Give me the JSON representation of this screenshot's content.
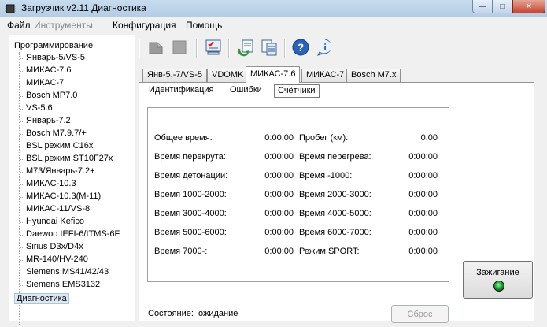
{
  "window": {
    "title": "Загрузчик v2.11 Диагностика",
    "controls": {
      "minimize": "—",
      "maximize": "□",
      "close": "✕"
    }
  },
  "menu": [
    "Файл",
    "Инструменты",
    "Конфигурация",
    "Помощь"
  ],
  "tree": {
    "root": "Программирование",
    "items": [
      "Январь-5/VS-5",
      "МИКАС-7.6",
      "МИКАС-7",
      "Bosch MP7.0",
      "VS-5.6",
      "Январь-7.2",
      "Bosch M7.9.7/+",
      "BSL режим C16x",
      "BSL режим ST10F27x",
      "M73/Январь-7.2+",
      "МИКАС-10.3",
      "МИКАС-10.3(M-11)",
      "МИКАС-11/VS-8",
      "Hyundai Kefico",
      "Daewoo IEFI-6/ITMS-6F",
      "Sirius D3x/D4x",
      "MR-140/HV-240",
      "Siemens MS41/42/43",
      "Siemens EMS3132"
    ],
    "selected": "Диагностика"
  },
  "toolbar": {
    "icons": [
      "read-icon",
      "stop-icon",
      "checklist-icon",
      "refresh-icon",
      "compare-icon",
      "help-icon",
      "info-icon"
    ]
  },
  "tabs": [
    "Янв-5,-7/VS-5",
    "VDOMK",
    "МИКАС-7.6",
    "МИКАС-7",
    "Bosch M7.x"
  ],
  "subtabs": [
    "Идентификация",
    "Ошибки",
    "Счётчики"
  ],
  "counters": {
    "left": [
      {
        "label": "Общее время:",
        "value": "0:00:00"
      },
      {
        "label": "Время перекрута:",
        "value": "0:00:00"
      },
      {
        "label": "Время детонации:",
        "value": "0:00:00"
      },
      {
        "label": "Время 1000-2000:",
        "value": "0:00:00"
      },
      {
        "label": "Время 3000-4000:",
        "value": "0:00:00"
      },
      {
        "label": "Время 5000-6000:",
        "value": "0:00:00"
      },
      {
        "label": "Время 7000-:",
        "value": "0:00:00"
      }
    ],
    "right": [
      {
        "label": "Пробег (км):",
        "value": "0.00"
      },
      {
        "label": "Время перегрева:",
        "value": "0:00:00"
      },
      {
        "label": "Время -1000:",
        "value": "0:00:00"
      },
      {
        "label": "Время 2000-3000:",
        "value": "0:00:00"
      },
      {
        "label": "Время 4000-5000:",
        "value": "0:00:00"
      },
      {
        "label": "Время 6000-7000:",
        "value": "0:00:00"
      },
      {
        "label": "Режим SPORT:",
        "value": "0:00:00"
      }
    ]
  },
  "status": {
    "label": "Состояние:",
    "value": "ожидание"
  },
  "reset_button": "Сброс",
  "ignition_button": "Зажигание",
  "colors": {
    "led_on": "#20a233",
    "title_bar": "#c9dcef"
  }
}
